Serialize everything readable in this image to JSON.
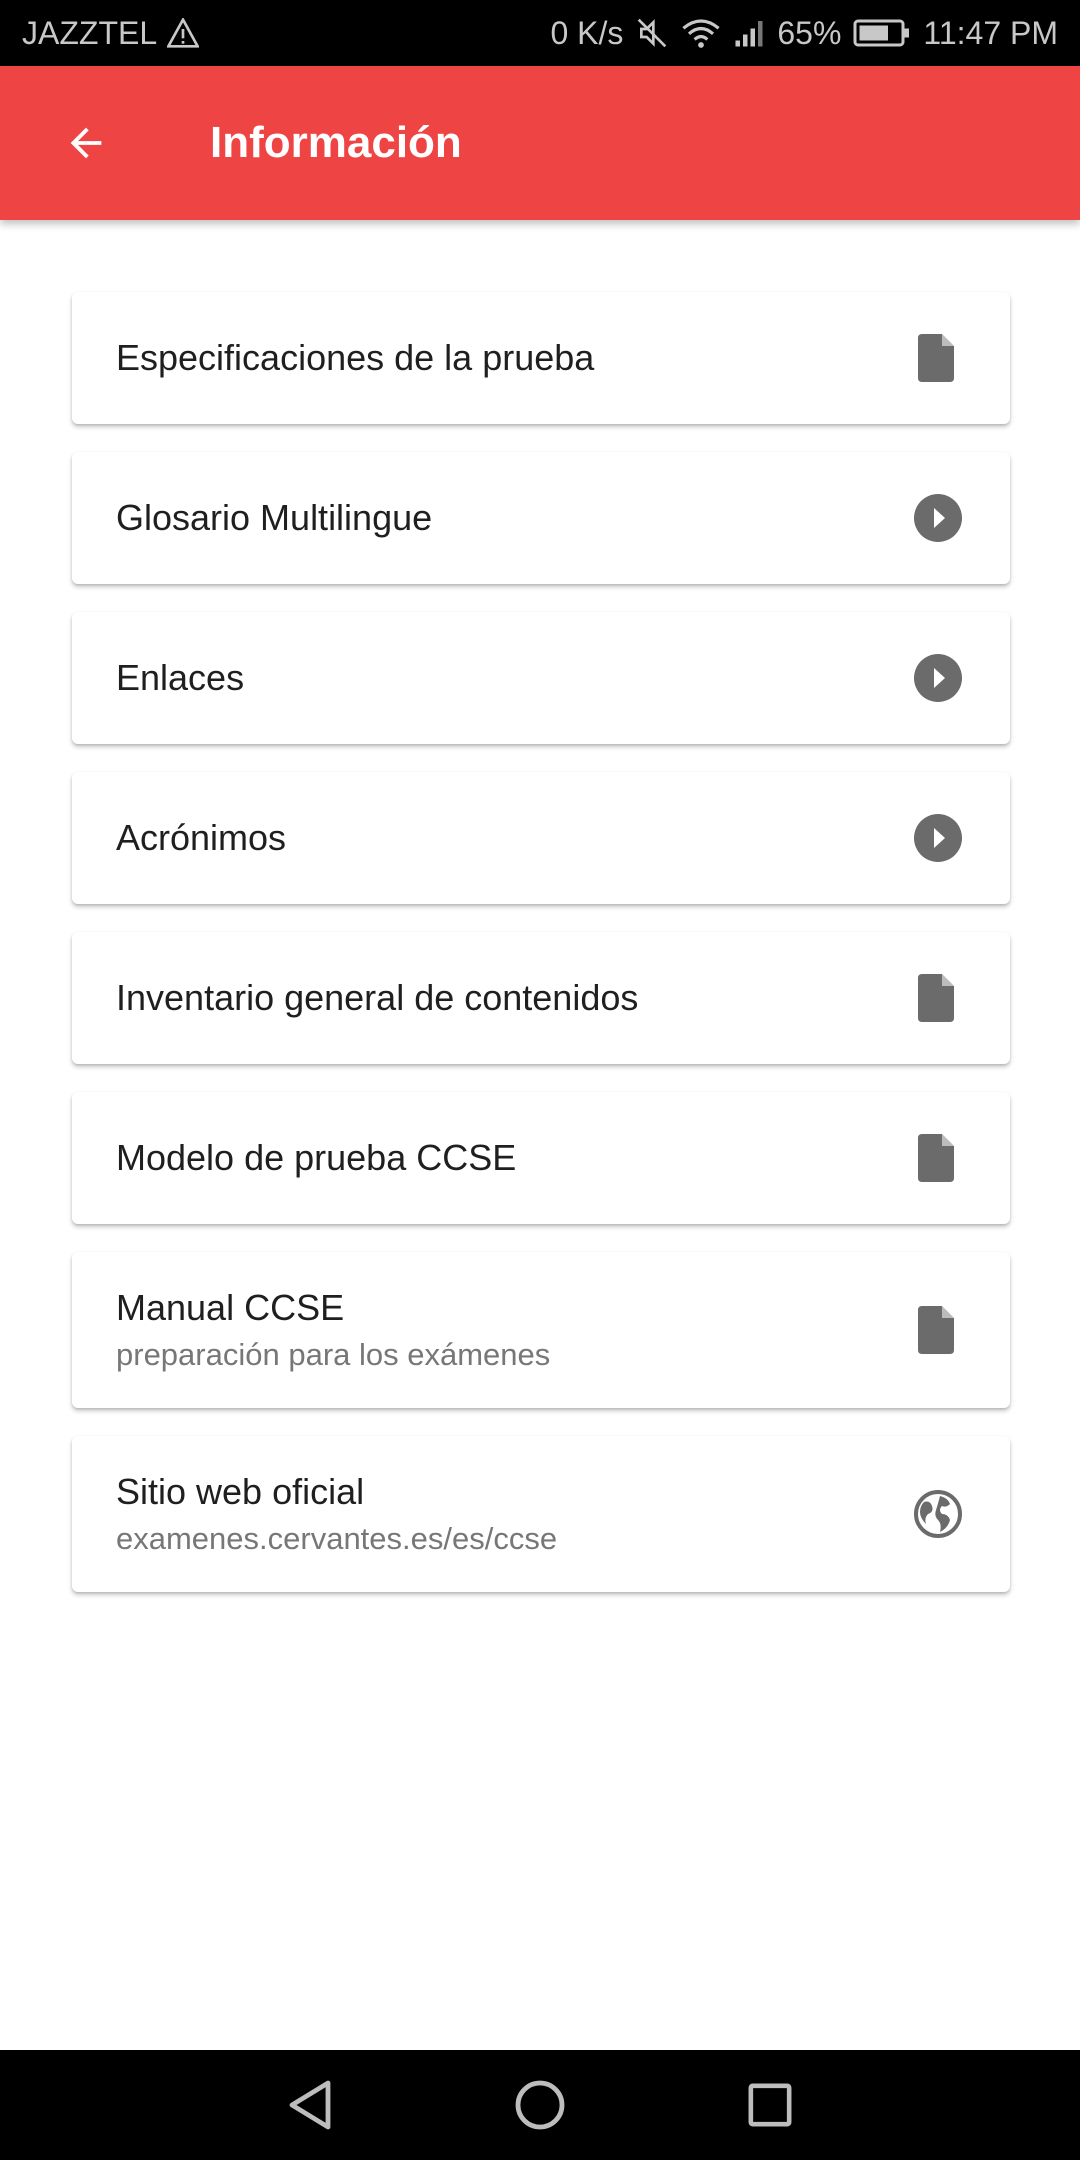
{
  "status_bar": {
    "carrier": "JAZZTEL",
    "net_speed": "0 K/s",
    "battery": "65%",
    "time": "11:47 PM"
  },
  "app_bar": {
    "title": "Información"
  },
  "items": [
    {
      "title": "Especificaciones de la prueba",
      "subtitle": "",
      "icon": "document-icon"
    },
    {
      "title": "Glosario Multilingue",
      "subtitle": "",
      "icon": "play-circle-icon"
    },
    {
      "title": "Enlaces",
      "subtitle": "",
      "icon": "play-circle-icon"
    },
    {
      "title": "Acrónimos",
      "subtitle": "",
      "icon": "play-circle-icon"
    },
    {
      "title": "Inventario general de contenidos",
      "subtitle": "",
      "icon": "document-icon"
    },
    {
      "title": "Modelo de prueba CCSE",
      "subtitle": "",
      "icon": "document-icon"
    },
    {
      "title": "Manual CCSE",
      "subtitle": "preparación para los exámenes",
      "icon": "document-icon"
    },
    {
      "title": "Sitio web oficial",
      "subtitle": "examenes.cervantes.es/es/ccse",
      "icon": "globe-icon"
    }
  ],
  "colors": {
    "app_bar": "#ef4444",
    "icon": "#6b6b6b"
  }
}
